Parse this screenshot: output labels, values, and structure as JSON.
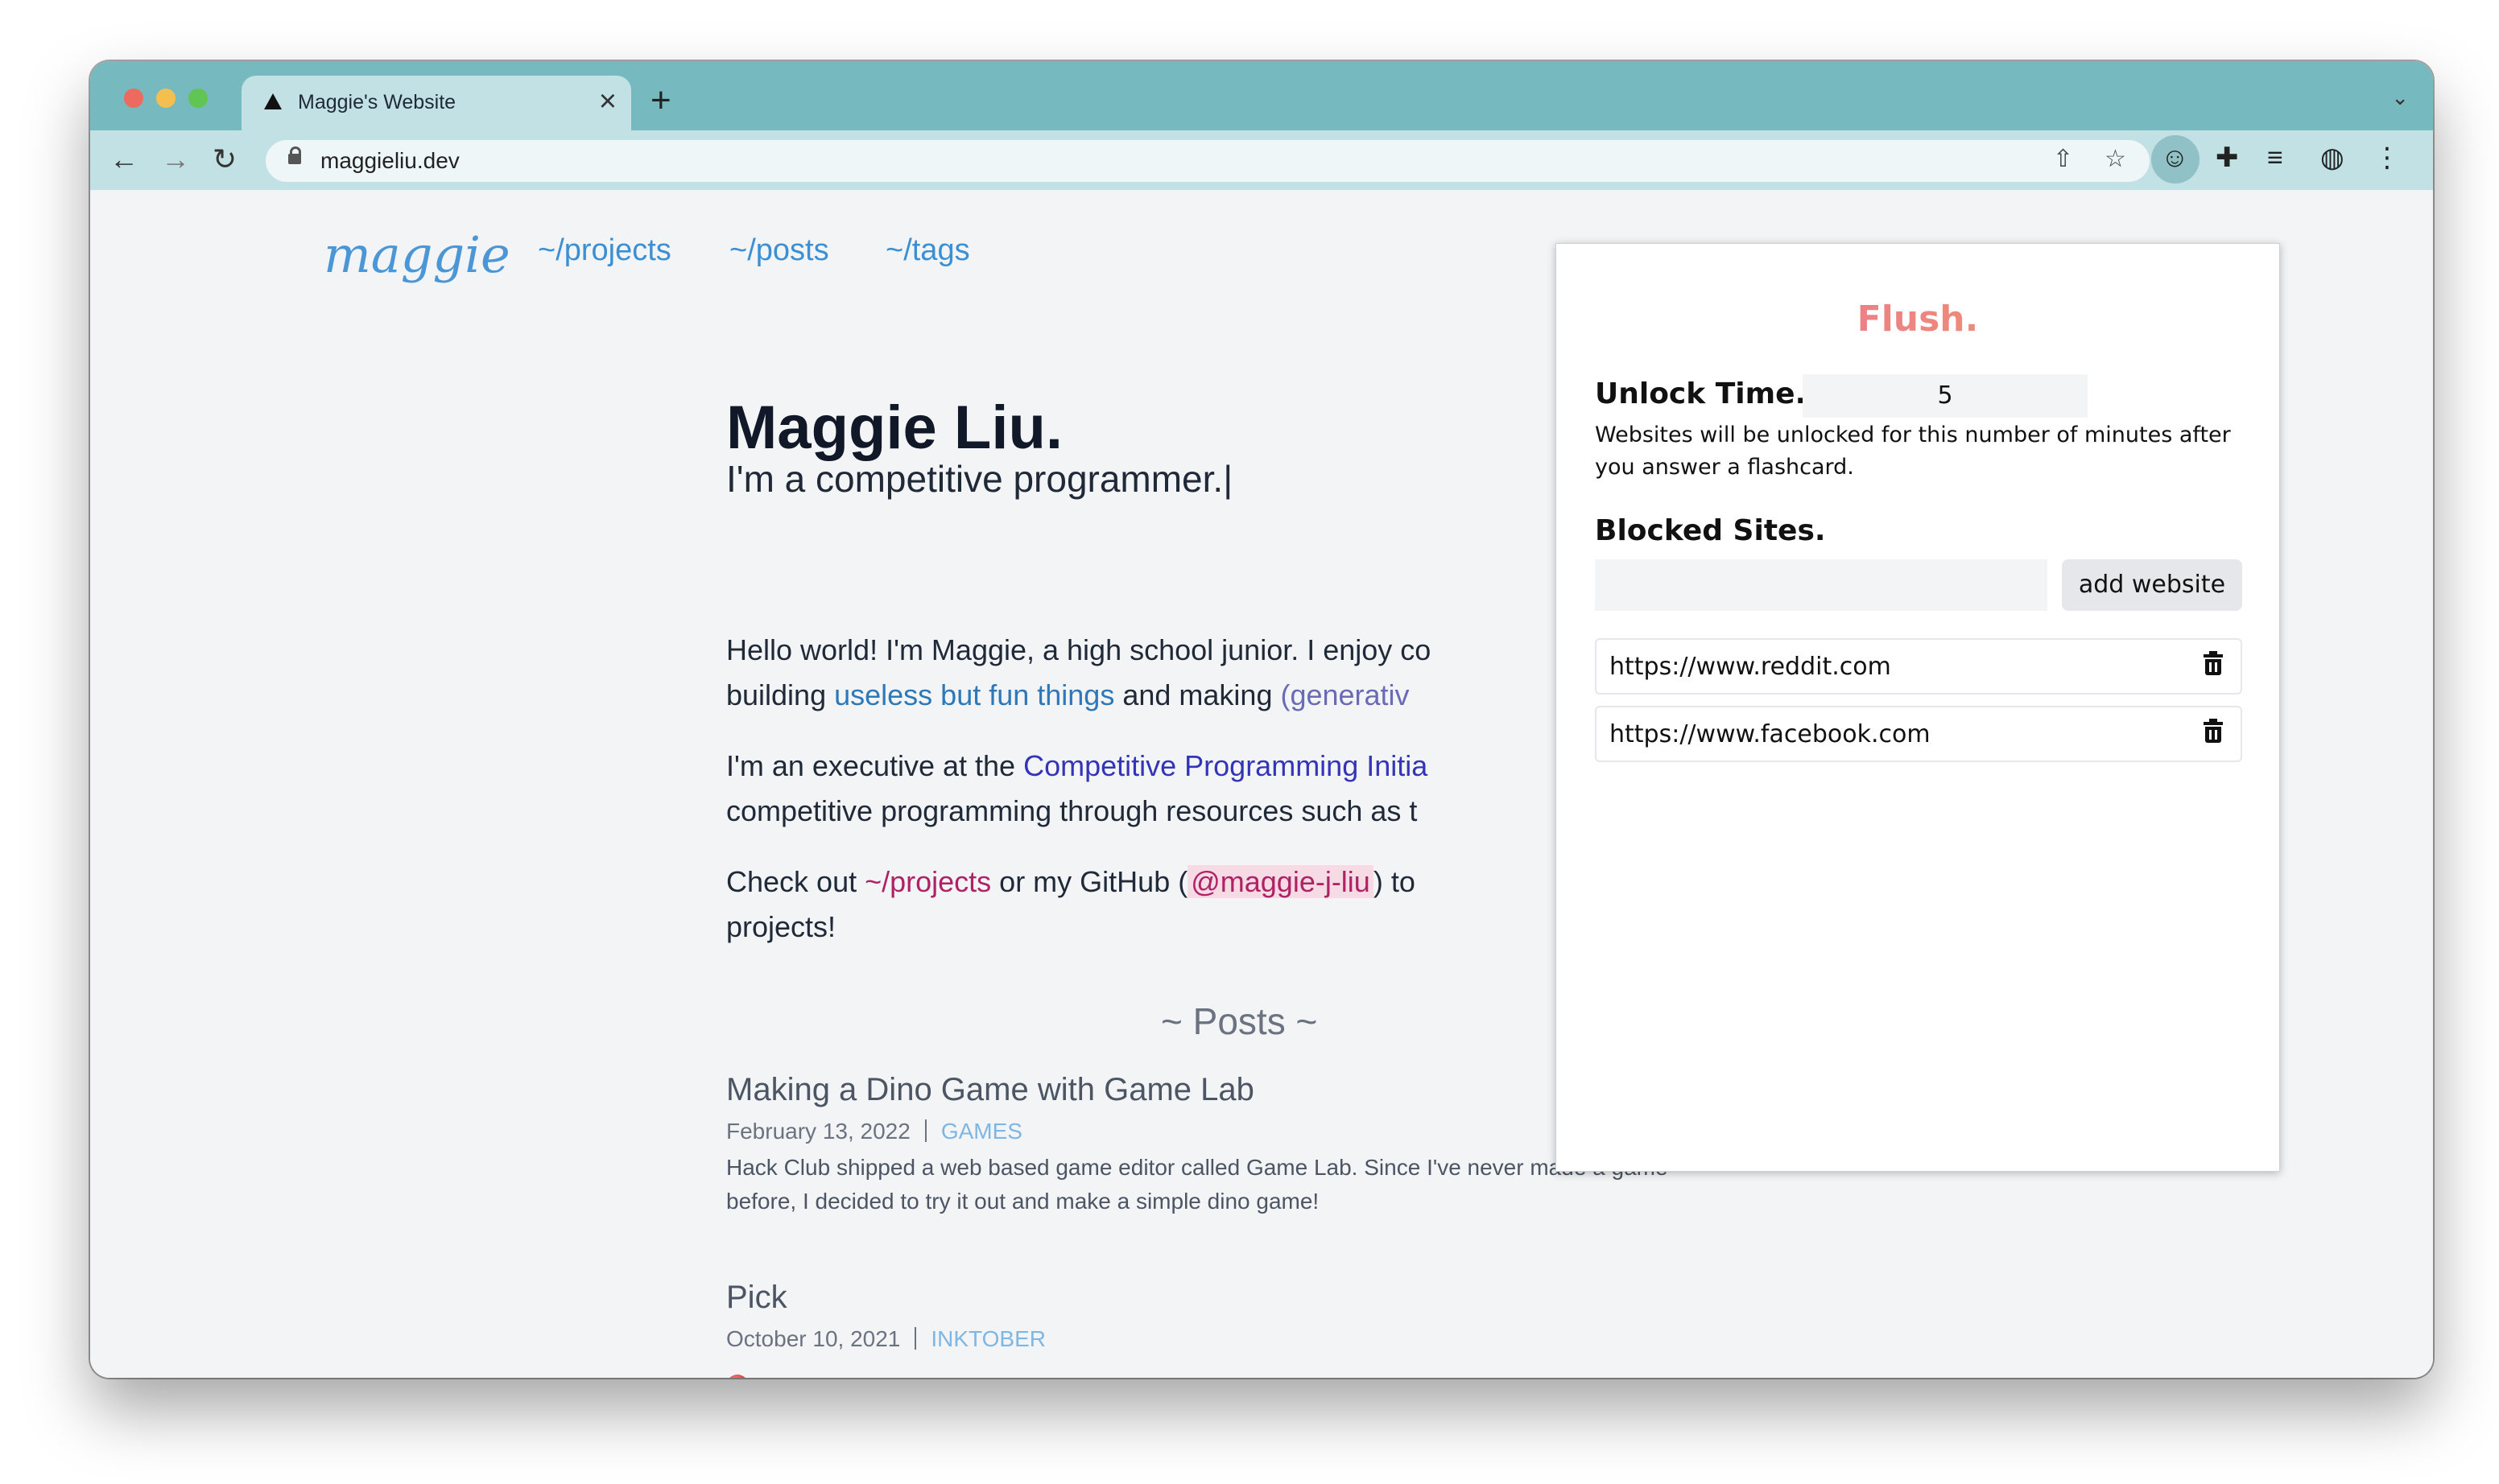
{
  "browser": {
    "tab_title": "Maggie's Website",
    "url": "maggieliu.dev"
  },
  "site": {
    "logo": "maggie",
    "nav": [
      "~/projects",
      "~/posts",
      "~/tags"
    ],
    "name": "Maggie Liu.",
    "subtitle": "I'm a competitive programmer.|",
    "intro": {
      "line1": "Hello world! I'm Maggie, a high school junior. I enjoy co",
      "line2_pre": "building ",
      "line2_link": "useless but fun things",
      "line2_mid": " and making ",
      "line2_link2": "(generativ"
    },
    "exec": {
      "pre": "I'm an executive at the ",
      "link": "Competitive Programming Initia",
      "line2": "competitive programming through resources such as t"
    },
    "checkout": {
      "pre": "Check out ",
      "link": "~/projects",
      "mid": " or my GitHub (",
      "github": "@maggie-j-liu",
      "post": ") to",
      "line2": "projects!"
    },
    "posts_heading": "~ Posts ~",
    "posts": [
      {
        "title": "Making a Dino Game with Game Lab",
        "date": "February 13, 2022",
        "tag": "GAMES",
        "excerpt": "Hack Club shipped a web based game editor called Game Lab. Since I've never made a game before, I decided to try it out and make a simple dino game!"
      },
      {
        "title": "Pick",
        "date": "October 10, 2021",
        "tag": "INKTOBER"
      }
    ]
  },
  "popup": {
    "title": "Flush.",
    "unlock_label": "Unlock Time.",
    "unlock_value": "5",
    "unlock_desc": "Websites will be unlocked for this number of minutes after you answer a flashcard.",
    "blocked_label": "Blocked Sites.",
    "site_input_value": "",
    "add_button": "add website",
    "blocked_sites": [
      "https://www.reddit.com",
      "https://www.facebook.com"
    ]
  },
  "colors": {
    "titlebar": "#76b9bf",
    "toolbar": "#c1e1e5",
    "accent_link": "#3b8fd3",
    "flush_gradient_start": "#e86aa6",
    "flush_gradient_end": "#f2a25a"
  }
}
